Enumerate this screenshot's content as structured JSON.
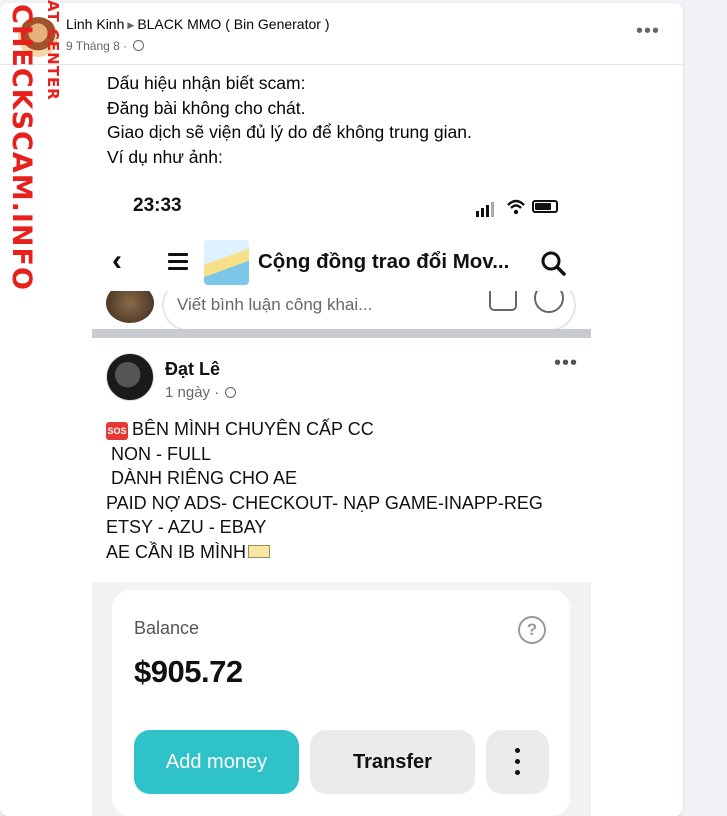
{
  "post": {
    "author": "Linh Kinh",
    "group": "BLACK MMO ( Bin Generator )",
    "date": "9 Tháng 8",
    "separator": "·",
    "more": "•••",
    "text_lines": [
      "Dấu hiệu nhận biết scam:",
      "Đăng bài không cho chát.",
      "Giao dịch sẽ viện đủ lý do để không trung gian.",
      "Ví dụ như ảnh:"
    ]
  },
  "watermark": {
    "main": "CHECKSCAM.INFO",
    "sub": "AT CENTER"
  },
  "screenshot": {
    "status_time": "23:33",
    "nav_title": "Cộng đồng trao đổi Mov...",
    "comment_placeholder": "Viết bình luận công khai...",
    "inner_post": {
      "author": "Đạt Lê",
      "time": "1 ngày",
      "separator": "·",
      "more": "•••",
      "sos_label": "SOS",
      "lines": [
        "BÊN MÌNH CHUYÊN CẤP CC",
        " NON - FULL",
        " DÀNH RIÊNG CHO AE",
        "PAID NỢ ADS- CHECKOUT- NẠP GAME-INAPP-REG",
        "ETSY - AZU - EBAY",
        "AE CẦN IB MÌNH"
      ]
    },
    "app": {
      "balance_label": "Balance",
      "help": "?",
      "balance_value": "$905.72",
      "add_money": "Add money",
      "transfer": "Transfer"
    }
  },
  "colors": {
    "watermark": "#e8201c",
    "add_money_bg": "#2fc2c9"
  }
}
